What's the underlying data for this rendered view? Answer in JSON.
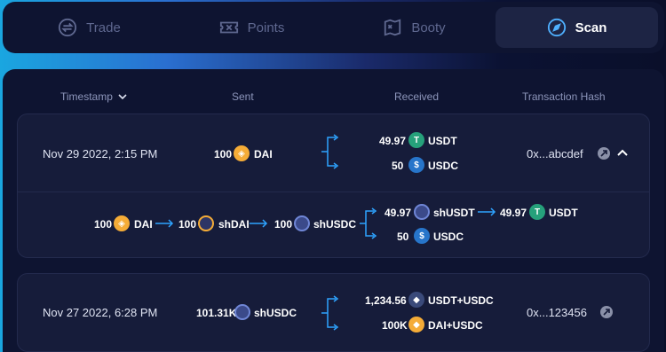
{
  "nav": {
    "tabs": [
      {
        "label": "Trade",
        "icon": "trade-icon",
        "active": false
      },
      {
        "label": "Points",
        "icon": "ticket-icon",
        "active": false
      },
      {
        "label": "Booty",
        "icon": "map-icon",
        "active": false
      },
      {
        "label": "Scan",
        "icon": "compass-icon",
        "active": true
      }
    ]
  },
  "table": {
    "headers": {
      "timestamp": "Timestamp",
      "sent": "Sent",
      "received": "Received",
      "hash": "Transaction Hash"
    },
    "rows": [
      {
        "timestamp": "Nov 29 2022, 2:15 PM",
        "sent": {
          "amount": "100",
          "token": "DAI"
        },
        "received": [
          {
            "amount": "49.97",
            "token": "USDT"
          },
          {
            "amount": "50",
            "token": "USDC"
          }
        ],
        "hash": "0x...abcdef",
        "expanded": true,
        "route": {
          "steps": [
            {
              "amount": "100",
              "token": "DAI"
            },
            {
              "amount": "100",
              "token": "shDAI"
            },
            {
              "amount": "100",
              "token": "shUSDC"
            }
          ],
          "branch_top_in": {
            "amount": "49.97",
            "token": "shUSDT"
          },
          "branch_top_out": {
            "amount": "49.97",
            "token": "USDT"
          },
          "branch_bottom": {
            "amount": "50",
            "token": "USDC"
          }
        }
      },
      {
        "timestamp": "Nov 27 2022, 6:28 PM",
        "sent": {
          "amount": "101.31K",
          "token": "shUSDC"
        },
        "received": [
          {
            "amount": "1,234.56",
            "token": "USDT+USDC"
          },
          {
            "amount": "100K",
            "token": "DAI+USDC"
          }
        ],
        "hash": "0x...123456",
        "expanded": false
      }
    ]
  },
  "colors": {
    "panel": "#0e1431",
    "card": "#161c3a",
    "accent_arrow": "#2ea3ff",
    "dai": "#f5ac37",
    "usdt": "#26a17b",
    "usdc": "#2775ca"
  }
}
